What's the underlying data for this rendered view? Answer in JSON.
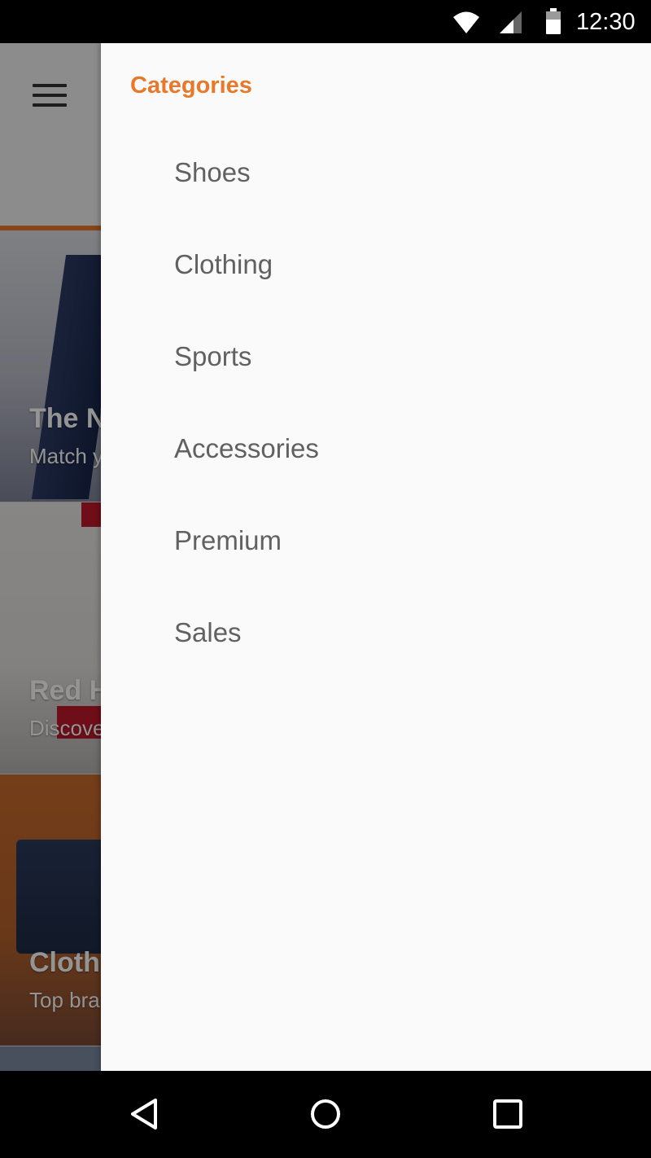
{
  "status_bar": {
    "time": "12:30",
    "icons": [
      "wifi-icon",
      "signal-icon",
      "battery-icon"
    ]
  },
  "app": {
    "toolbar": {
      "menu_icon": "menu-icon",
      "accent_color": "#e8782a"
    },
    "cards": [
      {
        "title": "The N",
        "subtitle": "Match y"
      },
      {
        "title": "Red H",
        "subtitle": "Discove"
      },
      {
        "title": "Clothi",
        "subtitle": "Top bra"
      }
    ]
  },
  "drawer": {
    "header": "Categories",
    "header_color": "#e8782a",
    "items": [
      {
        "label": "Shoes"
      },
      {
        "label": "Clothing"
      },
      {
        "label": "Sports"
      },
      {
        "label": "Accessories"
      },
      {
        "label": "Premium"
      },
      {
        "label": "Sales"
      }
    ]
  },
  "nav_bar": {
    "icons": [
      "back-icon",
      "home-icon",
      "recents-icon"
    ]
  }
}
